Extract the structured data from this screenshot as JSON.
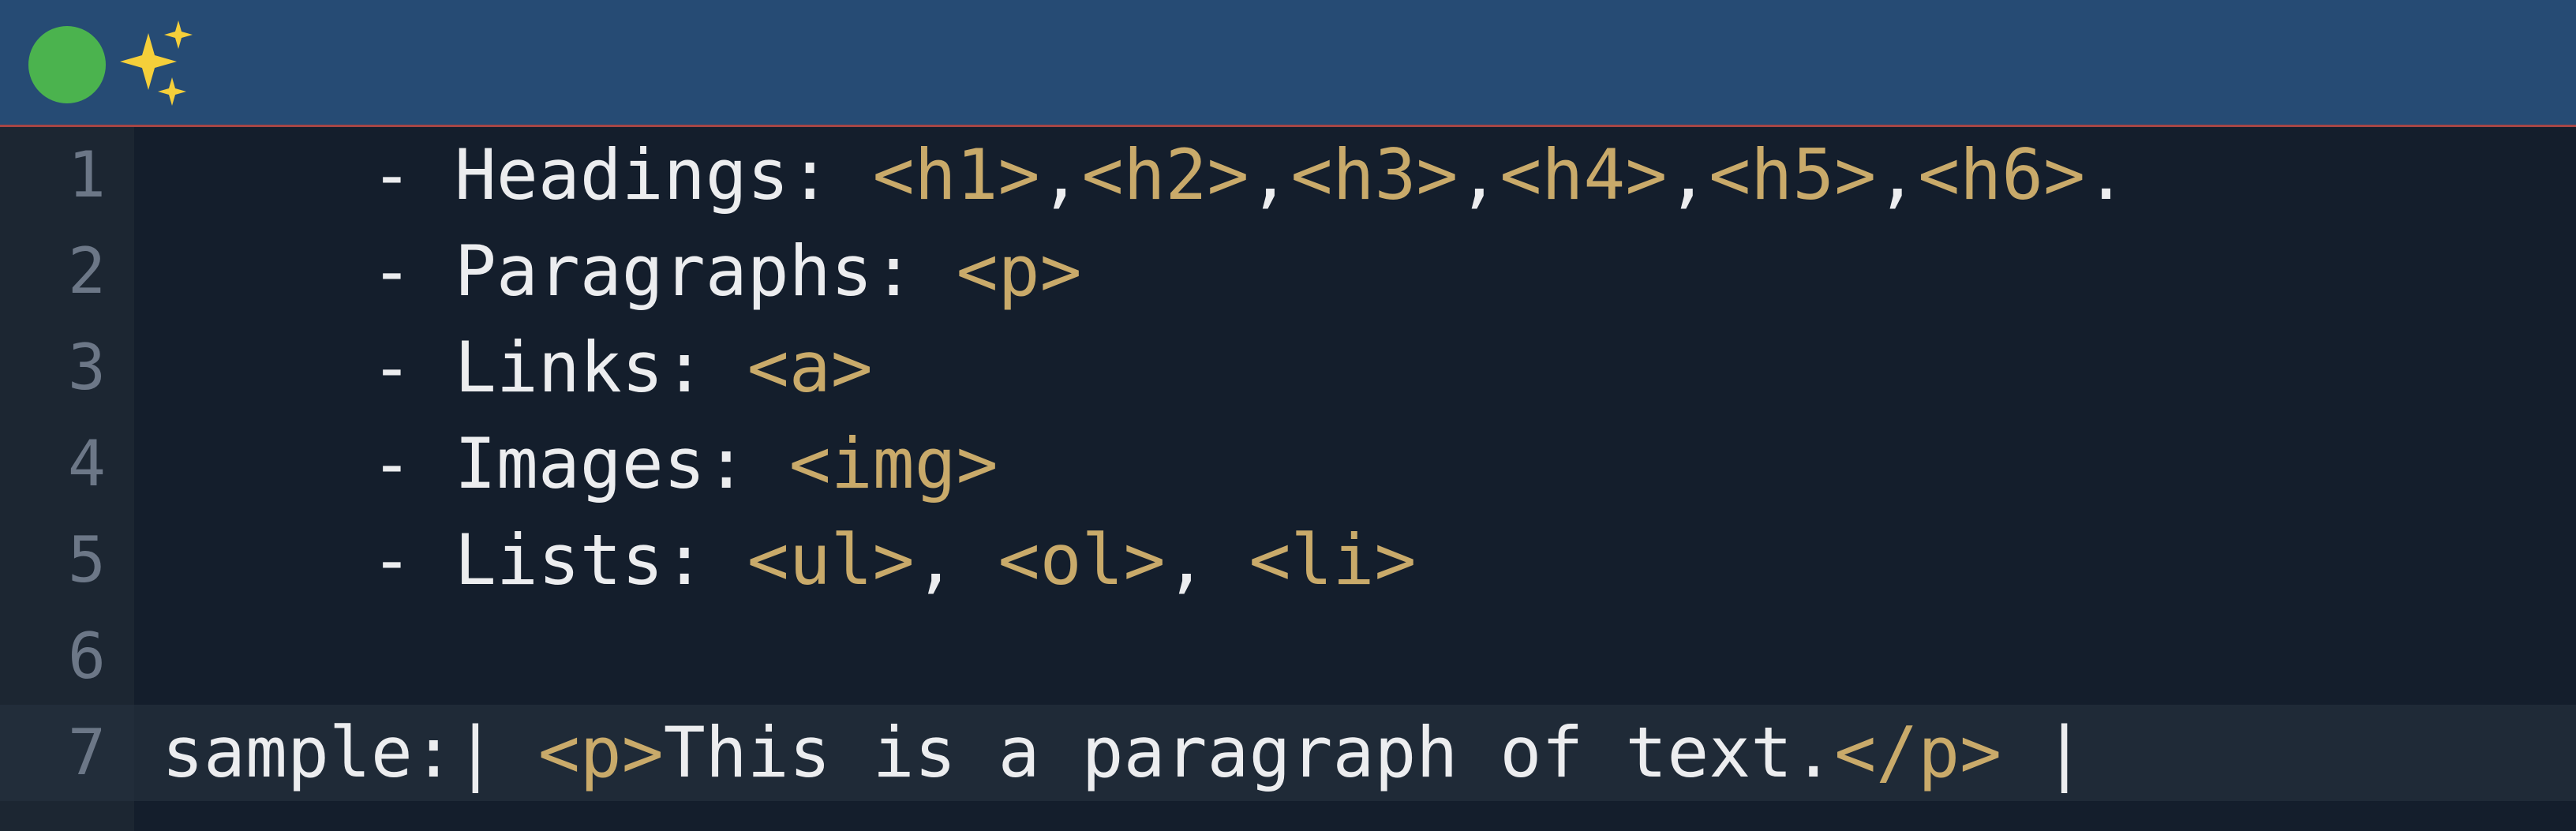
{
  "colors": {
    "titlebar": "#264b74",
    "accent_line": "#a64545",
    "editor_bg": "#141e2c",
    "gutter_bg": "#1c2632",
    "line_number": "#6c7787",
    "text": "#ecedef",
    "tag": "#c9aa6a",
    "status_dot": "#4bb34e",
    "sparkles": "#f5cf3a"
  },
  "titlebar": {
    "status_icon": "green-circle",
    "sparkles_icon": "sparkles"
  },
  "editor": {
    "current_line": 7,
    "lines": [
      {
        "number": "1",
        "segments": [
          {
            "text": "     - Headings: ",
            "kind": "txt"
          },
          {
            "text": "<h1>",
            "kind": "tag"
          },
          {
            "text": ",",
            "kind": "txt"
          },
          {
            "text": "<h2>",
            "kind": "tag"
          },
          {
            "text": ",",
            "kind": "txt"
          },
          {
            "text": "<h3>",
            "kind": "tag"
          },
          {
            "text": ",",
            "kind": "txt"
          },
          {
            "text": "<h4>",
            "kind": "tag"
          },
          {
            "text": ",",
            "kind": "txt"
          },
          {
            "text": "<h5>",
            "kind": "tag"
          },
          {
            "text": ",",
            "kind": "txt"
          },
          {
            "text": "<h6>",
            "kind": "tag"
          },
          {
            "text": ".",
            "kind": "txt"
          }
        ]
      },
      {
        "number": "2",
        "segments": [
          {
            "text": "     - Paragraphs: ",
            "kind": "txt"
          },
          {
            "text": "<p>",
            "kind": "tag"
          }
        ]
      },
      {
        "number": "3",
        "segments": [
          {
            "text": "     - Links: ",
            "kind": "txt"
          },
          {
            "text": "<a>",
            "kind": "tag"
          }
        ]
      },
      {
        "number": "4",
        "segments": [
          {
            "text": "     - Images: ",
            "kind": "txt"
          },
          {
            "text": "<img>",
            "kind": "tag"
          }
        ]
      },
      {
        "number": "5",
        "segments": [
          {
            "text": "     - Lists: ",
            "kind": "txt"
          },
          {
            "text": "<ul>",
            "kind": "tag"
          },
          {
            "text": ", ",
            "kind": "txt"
          },
          {
            "text": "<ol>",
            "kind": "tag"
          },
          {
            "text": ", ",
            "kind": "txt"
          },
          {
            "text": "<li>",
            "kind": "tag"
          }
        ]
      },
      {
        "number": "6",
        "segments": []
      },
      {
        "number": "7",
        "segments": [
          {
            "text": "sample:| ",
            "kind": "txt"
          },
          {
            "text": "<p>",
            "kind": "tag"
          },
          {
            "text": "This is a paragraph of text.",
            "kind": "txt"
          },
          {
            "text": "</p>",
            "kind": "tag"
          },
          {
            "text": " |",
            "kind": "txt"
          }
        ]
      }
    ]
  }
}
